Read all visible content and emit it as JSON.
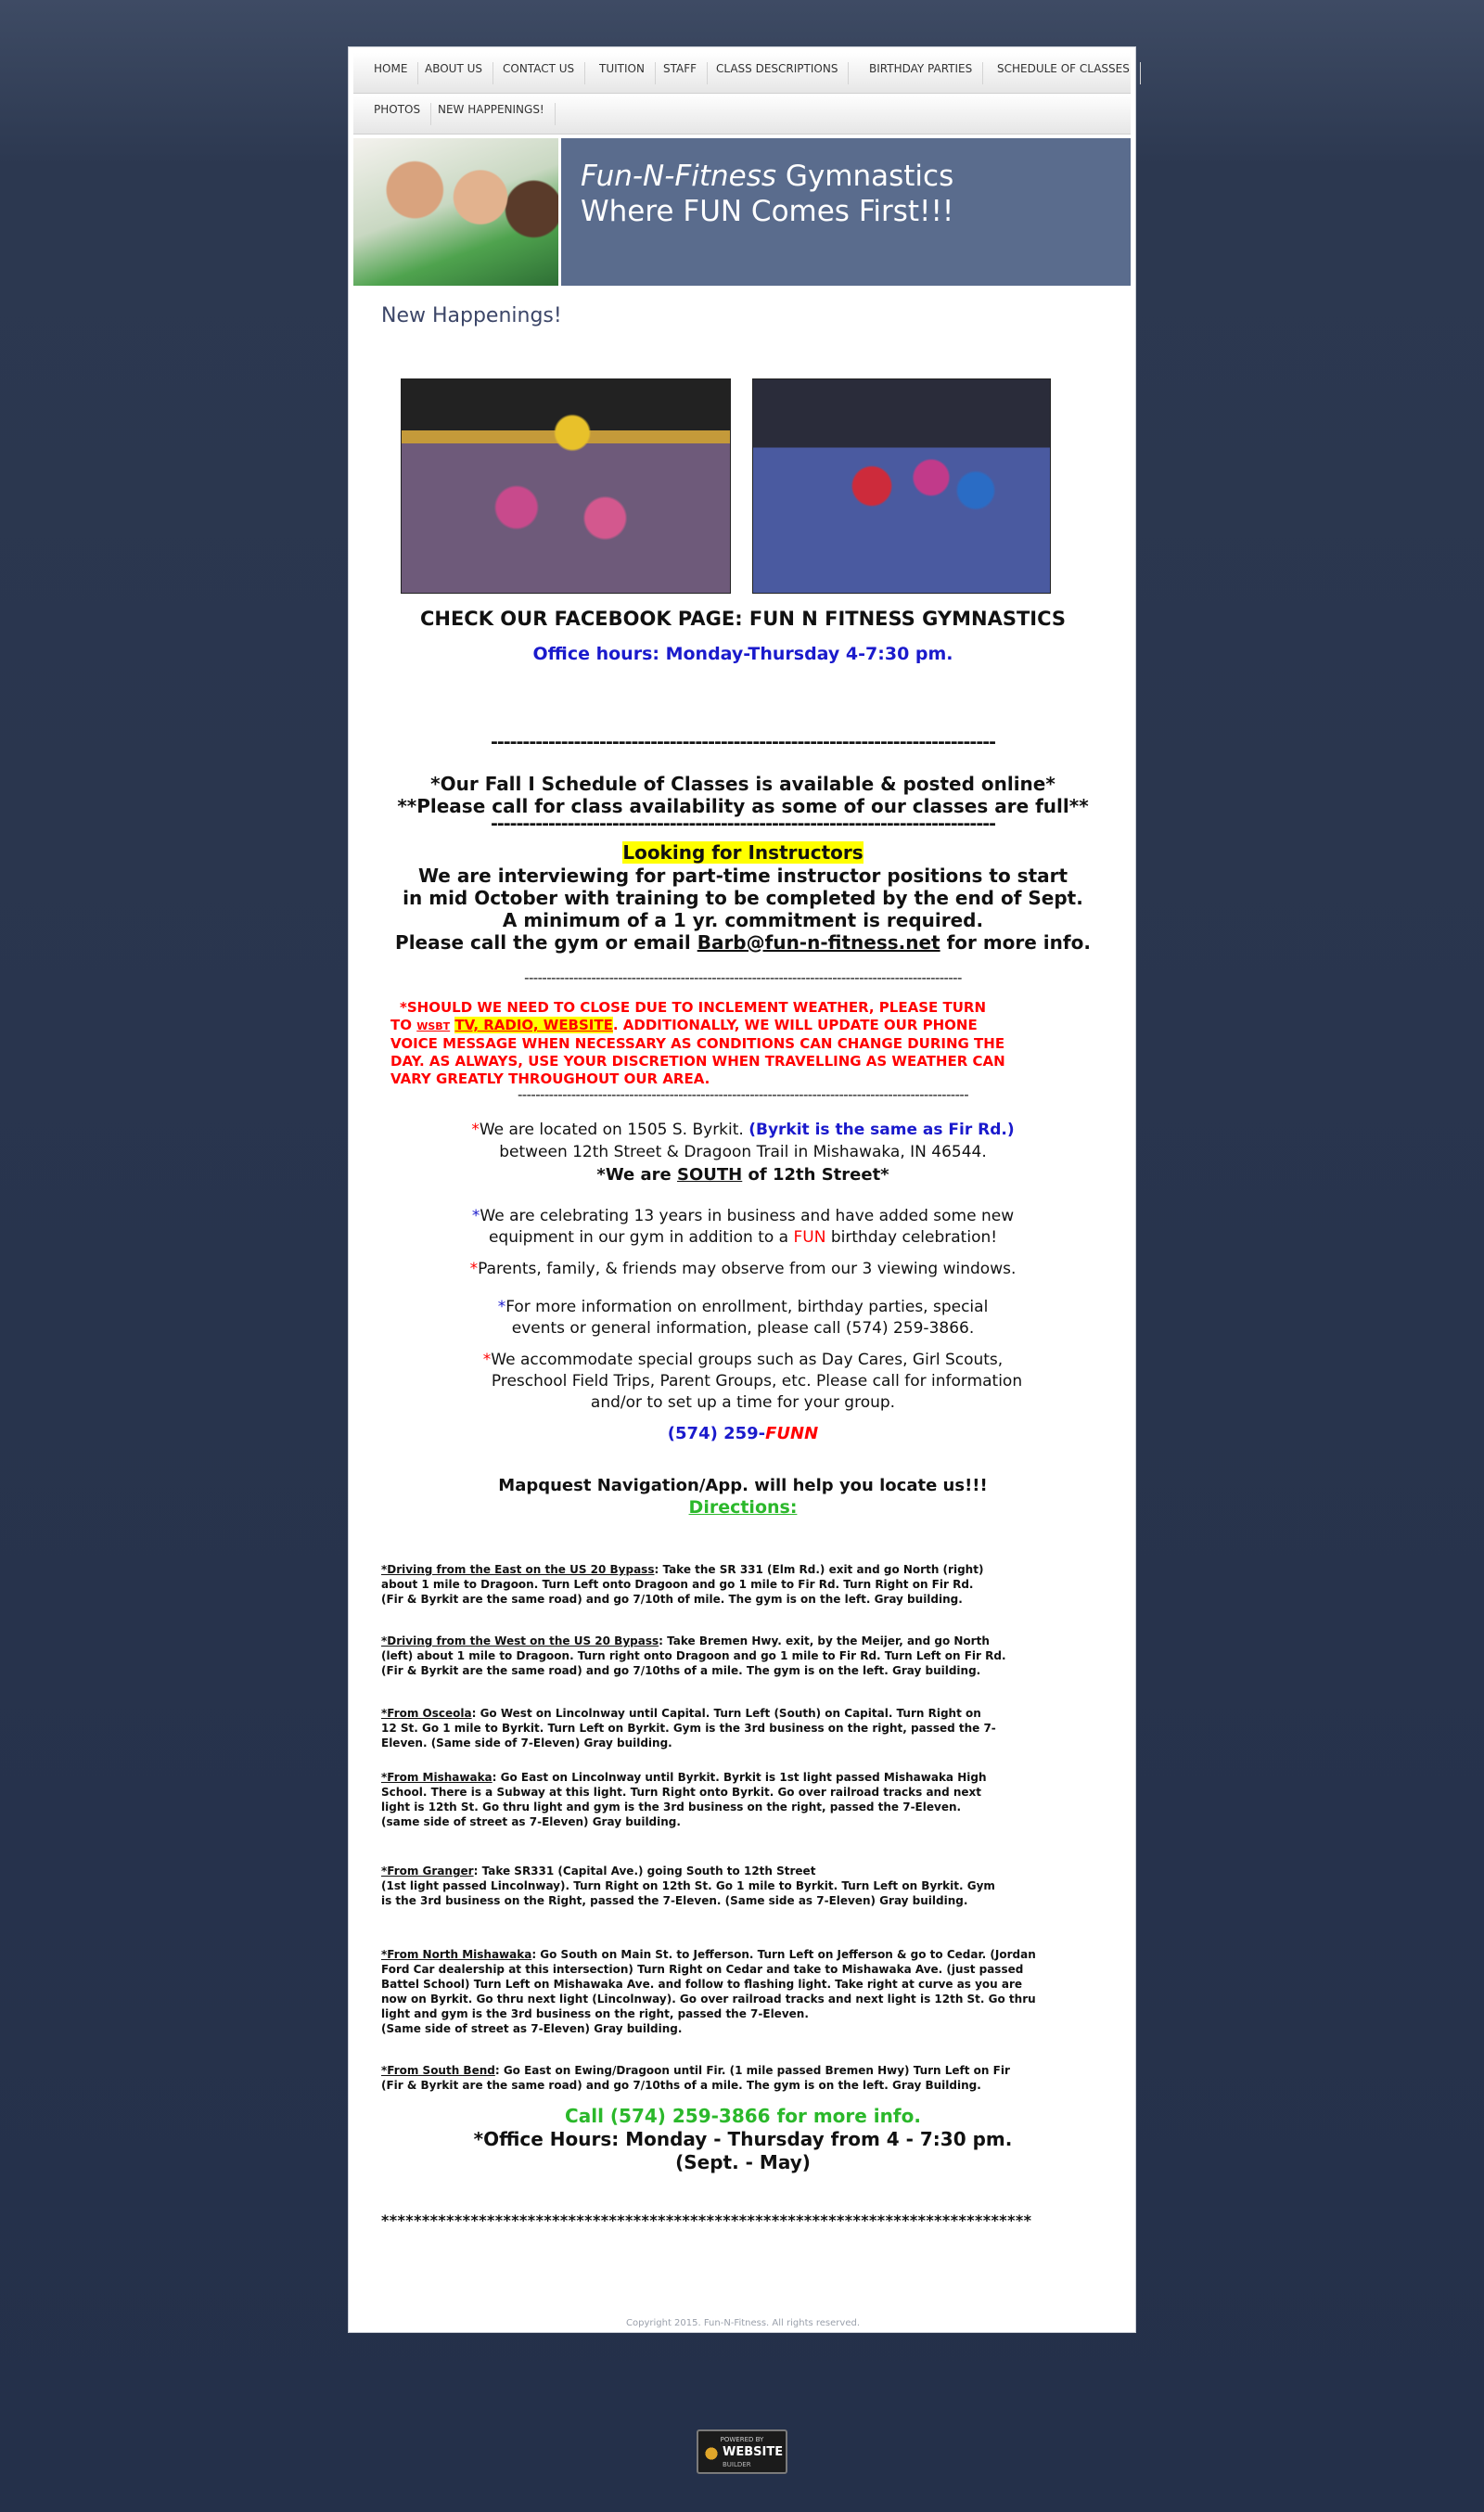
{
  "nav": {
    "row1": [
      "HOME",
      "ABOUT US",
      "CONTACT US",
      "TUITION",
      "STAFF",
      "CLASS DESCRIPTIONS",
      "BIRTHDAY PARTIES",
      "SCHEDULE OF CLASSES"
    ],
    "row2": [
      "PHOTOS",
      "NEW HAPPENINGS!"
    ]
  },
  "header": {
    "title_italic": "Fun-N-Fitness",
    "title_rest": " Gymnastics",
    "tagline": "Where FUN Comes First!!!"
  },
  "page": {
    "heading": "New Happenings!",
    "facebook": "CHECK OUR FACEBOOK PAGE:  FUN N FITNESS GYMNASTICS",
    "office_hours": "Office hours:  Monday-Thursday 4-7:30 pm.",
    "divider1": "-------------------------------------------------------------------------------",
    "schedule_line1": "*Our Fall I Schedule of Classes is available & posted online*",
    "schedule_line2": "**Please call for class availability as some of our classes are full**",
    "divider2": "-------------------------------------------------------------------------------",
    "instructors_heading": "Looking for Instructors",
    "instructors_line1": "We are interviewing for part-time instructor positions to start",
    "instructors_line2": "in mid October with training to be completed by the end of Sept.",
    "instructors_line3": "A minimum of a 1 yr. commitment is required.",
    "instructors_line4_pre": "Please call the gym or email ",
    "instructors_email": "Barb@fun-n-fitness.net",
    "instructors_line4_post": " for more info.",
    "divider3": "--------------------------------------------------------------------------------------------------",
    "weather_line1": "*SHOULD WE NEED TO CLOSE DUE TO INCLEMENT WEATHER, PLEASE TURN",
    "weather_line2_pre": "TO ",
    "weather_station": "WSBT",
    "weather_media": "TV, RADIO, WEBSITE",
    "weather_line2_post": ".  ADDITIONALLY, WE WILL UPDATE OUR PHONE",
    "weather_line3": "VOICE MESSAGE WHEN NECESSARY AS CONDITIONS CAN CHANGE DURING THE",
    "weather_line4": "DAY.  AS ALWAYS, USE YOUR DISCRETION WHEN TRAVELLING AS WEATHER CAN",
    "weather_line5": "VARY GREATLY THROUGHOUT OUR AREA.",
    "divider4": "-----------------------------------------------------------------------------------------------------",
    "location_line1": "We are located on 1505 S. Byrkit. ",
    "location_note": "(Byrkit is the same as Fir Rd.)",
    "location_line2": "between 12th Street & Dragoon Trail in Mishawaka, IN  46544.",
    "location_line3_pre": "*We are ",
    "location_south": "SOUTH",
    "location_line3_post": " of 12th Street*",
    "celebrating_line1": "We are celebrating 13 years in business and have added some new",
    "celebrating_line2_pre": "equipment in our gym in addition to a ",
    "celebrating_fun": "FUN",
    "celebrating_line2_post": " birthday celebration!",
    "parents": "Parents, family, & friends may observe from our 3 viewing windows.",
    "info_line1": "For more information on enrollment, birthday parties, special",
    "info_line2": "events or general information, please call (574) 259-3866.",
    "groups_line1": "We accommodate special groups such as Day Cares, Girl Scouts,",
    "groups_line2": "Preschool Field Trips, Parent Groups, etc.  Please call for information",
    "groups_line3": "and/or to set up a time for your group.",
    "phone_prefix": "(574) 259-",
    "phone_word": "FUNN",
    "mapquest": "Mapquest Navigation/App. will help you locate us!!!",
    "directions_heading": "Directions:",
    "directions": [
      {
        "heading": "*Driving from the East on the US 20 Bypass",
        "lines": [
          ":  Take the SR 331 (Elm Rd.) exit and go North (right)",
          "about 1 mile to Dragoon.  Turn Left onto Dragoon and go 1 mile to Fir Rd.  Turn Right on Fir Rd.",
          "(Fir & Byrkit are the same road) and go 7/10th of mile.  The gym is on the left.  Gray building."
        ]
      },
      {
        "heading": "*Driving from the West on the US 20 Bypass",
        "lines": [
          ":  Take Bremen Hwy. exit, by the Meijer, and go North",
          "(left) about 1 mile to Dragoon.  Turn right onto Dragoon and go 1 mile to Fir Rd.  Turn Left on Fir Rd.",
          "(Fir & Byrkit are the same road) and go 7/10ths of a mile.  The gym is on the left.  Gray building."
        ]
      },
      {
        "heading": "*From Osceola",
        "lines": [
          ":  Go West on Lincolnway until Capital.  Turn Left (South) on Capital. Turn Right on",
          "12 St.  Go 1 mile to Byrkit.  Turn Left on Byrkit.  Gym is the 3rd business on the right, passed the   7-",
          "Eleven.  (Same side of 7-Eleven) Gray building."
        ]
      },
      {
        "heading": "*From Mishawaka",
        "lines": [
          ":  Go East on Lincolnway until Byrkit.  Byrkit is 1st light passed Mishawaka High",
          "School.  There is a Subway at this light.  Turn Right onto Byrkit.  Go over railroad tracks and next",
          "light is 12th St.  Go thru light and gym is the 3rd business on the right, passed the 7-Eleven.",
          "(same side of street as 7-Eleven) Gray building."
        ]
      },
      {
        "heading": "*From Granger",
        "lines": [
          ":  Take SR331 (Capital Ave.) going South to 12th Street",
          "(1st light passed Lincolnway).  Turn Right on 12th St.  Go 1 mile to Byrkit.  Turn Left on Byrkit.  Gym",
          "is the 3rd business on the Right, passed the 7-Eleven. (Same side as 7-Eleven) Gray building."
        ]
      },
      {
        "heading": "*From North Mishawaka",
        "lines": [
          ":  Go South on Main St. to Jefferson.  Turn Left on Jefferson & go to Cedar. (Jordan",
          "Ford Car dealership at this intersection) Turn Right on Cedar and take to Mishawaka Ave. (just passed",
          "Battel School) Turn Left on Mishawaka Ave. and follow to flashing light. Take right at curve as you are",
          "now on Byrkit.   Go thru next light (Lincolnway). Go over railroad tracks and next light is 12th St.  Go thru",
          "light and gym is the 3rd business on the right, passed the 7-Eleven.",
          "(Same side of street as 7-Eleven) Gray building."
        ]
      },
      {
        "heading": "*From South Bend",
        "lines": [
          ":   Go East on Ewing/Dragoon until Fir. (1 mile passed Bremen Hwy)  Turn Left on Fir",
          "(Fir & Byrkit are the same road) and go 7/10ths of a mile.  The gym is on the left.  Gray Building."
        ]
      }
    ],
    "call_more": "Call (574) 259-3866 for more info.",
    "office_hours2": "*Office Hours:  Monday - Thursday from 4 - 7:30 pm.",
    "season": "(Sept. - May)",
    "stars": "********************************************************************************",
    "copyright": "Copyright 2015. Fun-N-Fitness. All rights reserved."
  },
  "badge": {
    "top": "POWERED BY",
    "main": "WEBSITE",
    "sub": "BUILDER"
  },
  "colors": {
    "background": "#2c3850",
    "header_band": "#5a6c8d",
    "office_hours": "#1a1acc",
    "weather_alert": "#ff0000",
    "directions": "#2bb82b",
    "highlight": "#ffff00"
  }
}
